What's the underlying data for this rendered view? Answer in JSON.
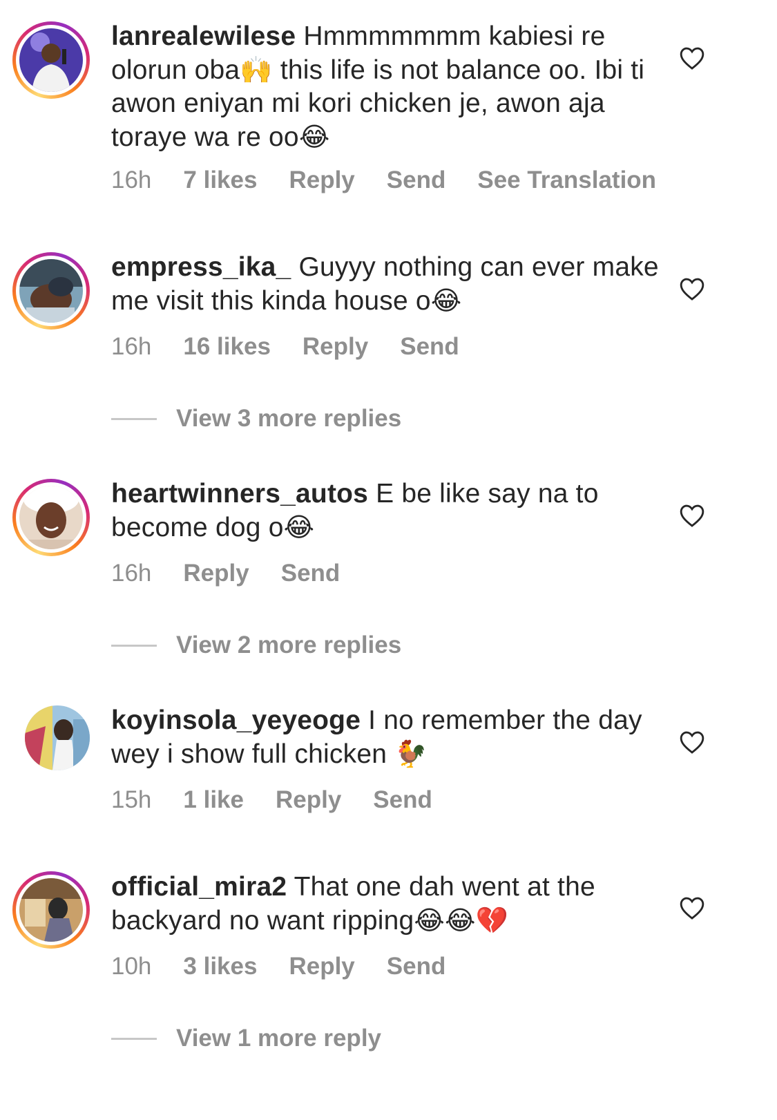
{
  "comments": [
    {
      "username": "lanrealewilese",
      "text_parts": [
        "Hmmmmmmm kabiesi re olorun oba",
        "🙌",
        " this life is not balance oo. Ibi ti awon eniyan mi kori chicken je, awon aja toraye wa re oo",
        "😂"
      ],
      "time": "16h",
      "likes": "7 likes",
      "reply": "Reply",
      "send": "Send",
      "translation": "See Translation",
      "avatar_story_ring": true
    },
    {
      "username": "empress_ika_",
      "text_parts": [
        "Guyyy nothing can ever make me visit this kinda house o",
        "😂"
      ],
      "time": "16h",
      "likes": "16 likes",
      "reply": "Reply",
      "send": "Send",
      "view_replies": "View 3 more replies",
      "avatar_story_ring": true
    },
    {
      "username": "heartwinners_autos",
      "text_parts": [
        "E be like say na to become dog o",
        "😂"
      ],
      "time": "16h",
      "reply": "Reply",
      "send": "Send",
      "view_replies": "View 2 more replies",
      "avatar_story_ring": true
    },
    {
      "username": "koyinsola_yeyeoge",
      "text_parts": [
        "I no remember the day wey i show full chicken ",
        "🐓"
      ],
      "time": "15h",
      "likes": "1 like",
      "reply": "Reply",
      "send": "Send",
      "avatar_story_ring": false
    },
    {
      "username": "official_mira2",
      "text_parts": [
        "That one dah went at the backyard no want ripping",
        "😂😂💔"
      ],
      "time": "10h",
      "likes": "3 likes",
      "reply": "Reply",
      "send": "Send",
      "view_replies": "View 1 more reply",
      "avatar_story_ring": true
    }
  ],
  "icons": {
    "like": "heart-outline-icon"
  },
  "colors": {
    "text": "#262626",
    "secondary": "#8e8e8e",
    "ring_start": "#feda75",
    "ring_end": "#962fbf"
  }
}
